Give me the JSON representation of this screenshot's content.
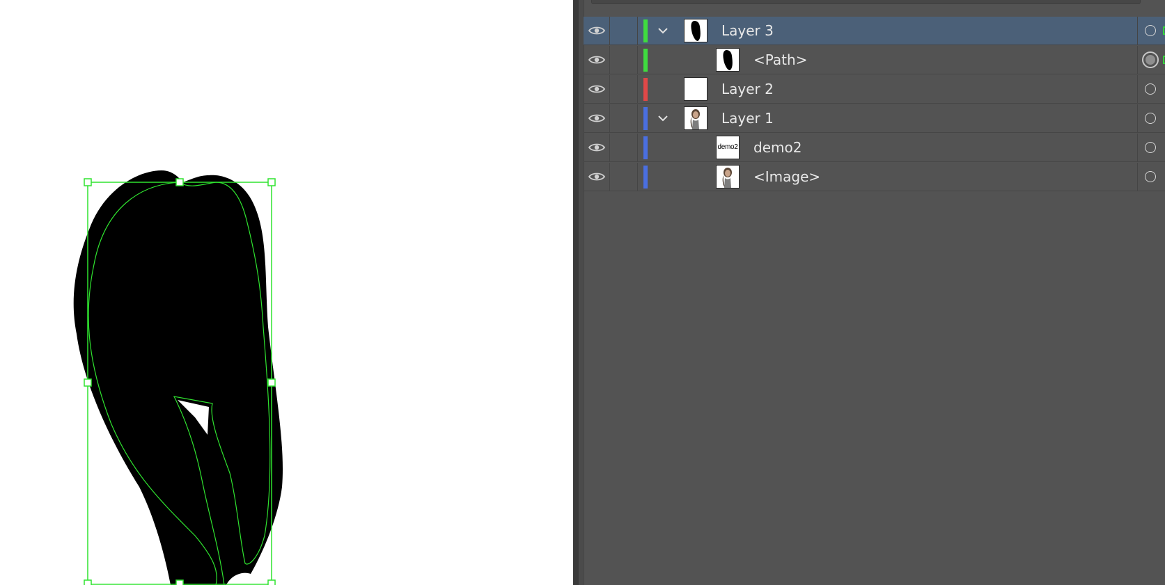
{
  "canvas": {
    "artwork": "black-path-shape",
    "selection_color": "#2fe32f"
  },
  "layers_panel": {
    "rows": [
      {
        "name": "Layer 3",
        "color": "#3fdc3f",
        "expanded": true,
        "selected": true,
        "thumb": "black-shape-thumbnail",
        "target": "hollow"
      },
      {
        "name": "<Path>",
        "color": "#3fdc3f",
        "thumb": "black-shape-thumbnail",
        "target": "filled"
      },
      {
        "name": "Layer 2",
        "color": "#e04848",
        "thumb": "blank-thumbnail",
        "target": "hollow"
      },
      {
        "name": "Layer 1",
        "color": "#4a6fe0",
        "expanded": true,
        "thumb": "portrait-thumbnail",
        "target": "hollow"
      },
      {
        "name": "demo2",
        "color": "#4a6fe0",
        "thumb_text": "demo2",
        "target": "hollow"
      },
      {
        "name": "<Image>",
        "color": "#4a6fe0",
        "thumb": "portrait-thumbnail",
        "target": "hollow"
      }
    ],
    "icons": {
      "visibility": "eye-icon",
      "expand": "chevron-down-icon",
      "target": "target-circle-icon"
    }
  }
}
